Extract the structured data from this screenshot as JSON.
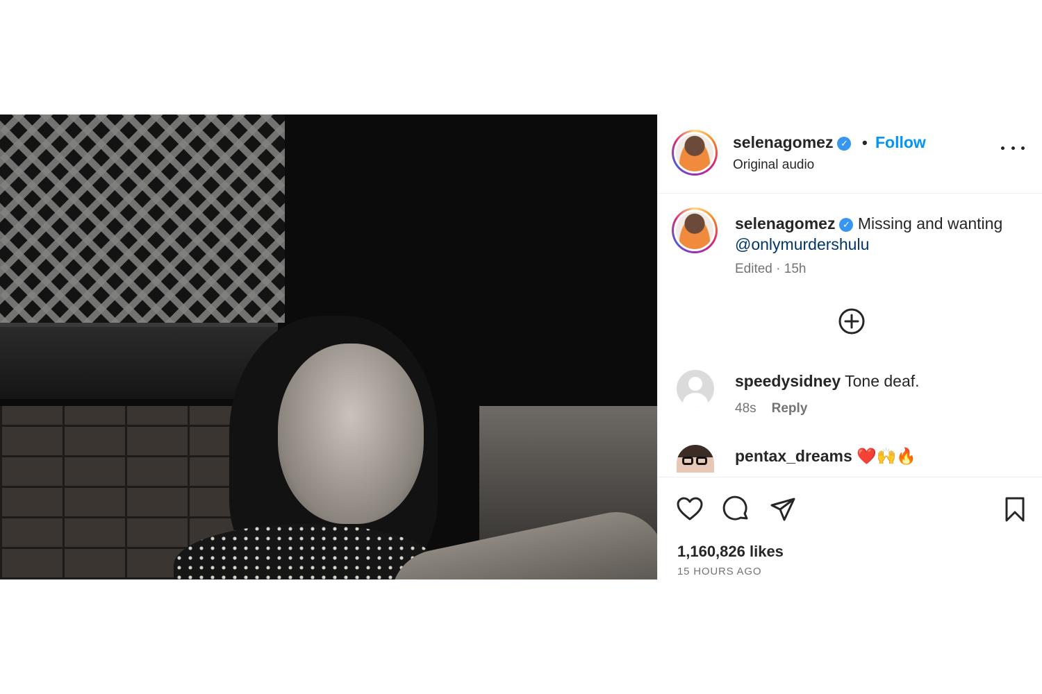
{
  "post": {
    "media": {
      "description_icon": "photo"
    },
    "header": {
      "username": "selenagomez",
      "verified_icon": "verified-badge-icon",
      "separator": "•",
      "follow_label": "Follow",
      "audio": "Original audio",
      "more_icon": "more-options-icon"
    },
    "caption": {
      "username": "selenagomez",
      "text_before": "Missing and wanting ",
      "mention": "@onlymurdershulu",
      "meta": "Edited · 15h"
    },
    "load_more_icon": "plus-circle-icon",
    "comments": [
      {
        "username": "speedysidney",
        "text": "Tone deaf.",
        "time": "48s",
        "reply_label": "Reply"
      },
      {
        "username": "pentax_dreams",
        "text": "❤️🙌🔥"
      }
    ],
    "actions": {
      "icons": [
        "heart-icon",
        "comment-icon",
        "share-icon",
        "bookmark-icon"
      ],
      "likes": "1,160,826 likes",
      "time_ago": "15 HOURS AGO"
    },
    "colors": {
      "follow": "#0095f6",
      "mention": "#00376b",
      "verified": "#3797f0",
      "meta": "#737373"
    }
  }
}
